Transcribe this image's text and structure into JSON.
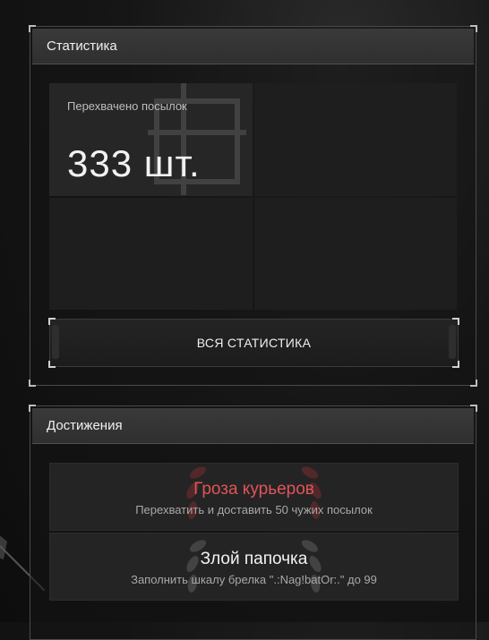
{
  "stats": {
    "header": "Статистика",
    "cells": [
      {
        "label": "Перехвачено посылок",
        "value": "333 шт."
      },
      {
        "label": "",
        "value": ""
      },
      {
        "label": "",
        "value": ""
      },
      {
        "label": "",
        "value": ""
      }
    ],
    "all_button": "ВСЯ СТАТИСТИКА"
  },
  "achievements": {
    "header": "Достижения",
    "items": [
      {
        "title": "Гроза курьеров",
        "description": "Перехватить и доставить 50 чужих посылок",
        "highlight": true
      },
      {
        "title": "Злой папочка",
        "description": "Заполнить шкалу брелка \".:Nag!batOr:.\" до 99",
        "highlight": false
      }
    ]
  },
  "colors": {
    "accent_red": "#e0545a",
    "panel_header": "#333333"
  }
}
